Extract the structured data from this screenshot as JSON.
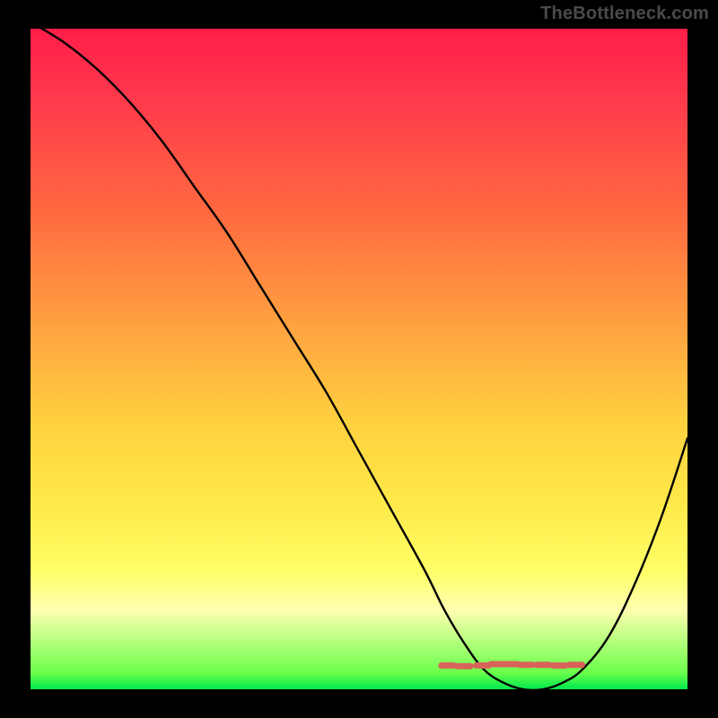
{
  "watermark": "TheBottleneck.com",
  "colors": {
    "background": "#000000",
    "curve": "#000000",
    "marker_fill": "#d9625a",
    "marker_stroke": "#d9625a",
    "watermark": "#4a4a4a"
  },
  "chart_data": {
    "type": "line",
    "title": "",
    "xlabel": "",
    "ylabel": "",
    "xlim": [
      0,
      100
    ],
    "ylim": [
      0,
      100
    ],
    "series": [
      {
        "name": "bottleneck-curve",
        "x": [
          0,
          5,
          10,
          15,
          20,
          25,
          30,
          35,
          40,
          45,
          50,
          55,
          60,
          63,
          66,
          69,
          72,
          75,
          78,
          81,
          84,
          88,
          92,
          96,
          100
        ],
        "y": [
          101,
          98,
          94,
          89,
          83,
          76,
          69,
          61,
          53,
          45,
          36,
          27,
          18,
          12,
          7,
          3,
          1,
          0,
          0,
          1,
          3,
          8,
          16,
          26,
          38
        ]
      }
    ],
    "markers": {
      "name": "optimal-range",
      "x": [
        63.5,
        66,
        68.8,
        71,
        73.2,
        75.5,
        78,
        80.5,
        83
      ],
      "y": [
        3.6,
        3.5,
        3.6,
        3.8,
        3.8,
        3.7,
        3.7,
        3.6,
        3.7
      ]
    },
    "gradient_stops": [
      {
        "pos": 0.0,
        "color": "#ff1e4a"
      },
      {
        "pos": 0.12,
        "color": "#ff3d4b"
      },
      {
        "pos": 0.28,
        "color": "#ff6a3f"
      },
      {
        "pos": 0.42,
        "color": "#ff9840"
      },
      {
        "pos": 0.6,
        "color": "#ffd23f"
      },
      {
        "pos": 0.72,
        "color": "#ffe94a"
      },
      {
        "pos": 0.82,
        "color": "#ffff66"
      },
      {
        "pos": 0.88,
        "color": "#ffffb0"
      },
      {
        "pos": 0.975,
        "color": "#6bff4a"
      },
      {
        "pos": 1.0,
        "color": "#00e84e"
      }
    ]
  }
}
